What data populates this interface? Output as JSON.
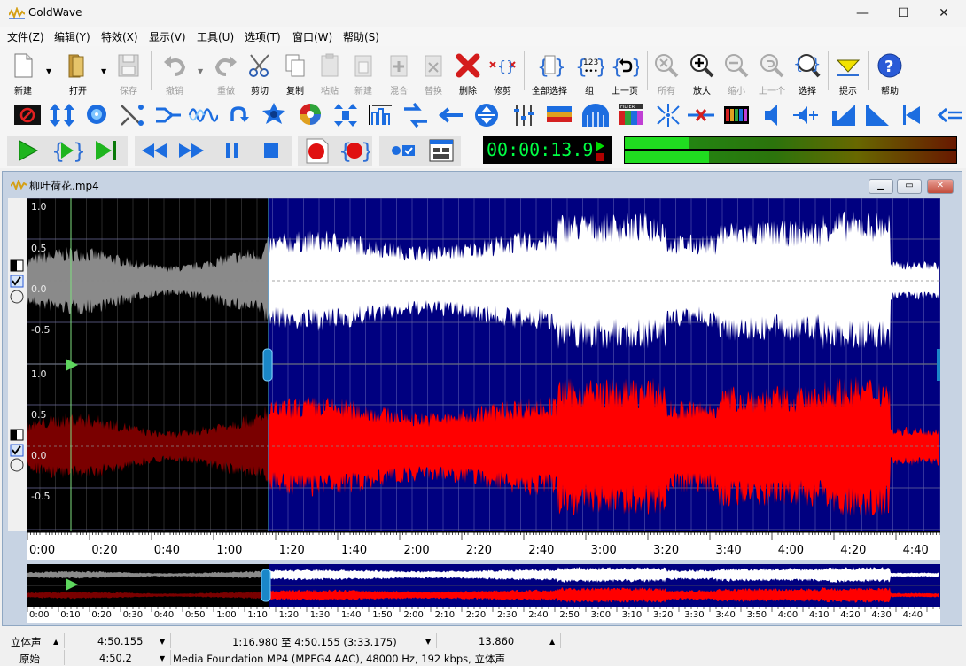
{
  "app": {
    "title": "GoldWave"
  },
  "window_controls": {
    "minimize": "—",
    "maximize": "☐",
    "close": "✕"
  },
  "menu": [
    "文件(Z)",
    "编辑(Y)",
    "特效(X)",
    "显示(V)",
    "工具(U)",
    "选项(T)",
    "窗口(W)",
    "帮助(S)"
  ],
  "toolbar": {
    "buttons": [
      {
        "label": "新建",
        "icon": "new-file-icon"
      },
      {
        "label": "打开",
        "icon": "open-folder-icon"
      },
      {
        "label": "保存",
        "icon": "save-icon"
      },
      {
        "label": "撤销",
        "icon": "undo-icon"
      },
      {
        "label": "重做",
        "icon": "redo-icon"
      },
      {
        "label": "剪切",
        "icon": "cut-icon"
      },
      {
        "label": "复制",
        "icon": "copy-icon"
      },
      {
        "label": "粘贴",
        "icon": "paste-icon"
      },
      {
        "label": "新建",
        "icon": "paste-new-icon"
      },
      {
        "label": "混合",
        "icon": "mix-icon"
      },
      {
        "label": "替换",
        "icon": "replace-icon"
      },
      {
        "label": "删除",
        "icon": "delete-icon"
      },
      {
        "label": "修剪",
        "icon": "trim-icon"
      },
      {
        "label": "全部选择",
        "icon": "select-all-icon"
      },
      {
        "label": "组",
        "icon": "group-icon"
      },
      {
        "label": "上一页",
        "icon": "previous-page-icon"
      },
      {
        "label": "所有",
        "icon": "zoom-all-icon"
      },
      {
        "label": "放大",
        "icon": "zoom-in-icon"
      },
      {
        "label": "缩小",
        "icon": "zoom-out-icon"
      },
      {
        "label": "上一个",
        "icon": "zoom-previous-icon"
      },
      {
        "label": "选择",
        "icon": "zoom-selection-icon"
      },
      {
        "label": "提示",
        "icon": "cue-icon"
      },
      {
        "label": "帮助",
        "icon": "help-icon"
      }
    ]
  },
  "effects_toolbar": [
    "dc-offset-icon",
    "compressor-icon",
    "doppler-icon",
    "echo-icon",
    "equalizer-icon",
    "flanger-icon",
    "invert-icon",
    "reverb-icon",
    "mechanize-icon",
    "noise-reduction-icon",
    "pitch-icon",
    "playback-rate-icon",
    "reverse-icon",
    "resample-icon",
    "volume-shape-icon",
    "channel-mixer-icon",
    "time-warp-icon",
    "spectrum-filter-icon",
    "pan-icon",
    "pop-click-icon",
    "clip-remove-icon",
    "spectrum-icon",
    "speaker-icon",
    "volume-change-icon",
    "fade-in-icon",
    "fade-out-icon",
    "auto-gain-icon",
    "more-effects-icon"
  ],
  "transport": {
    "time": "00:00:13.9",
    "buttons": [
      "play-icon",
      "play-selection-icon",
      "play-to-end-icon",
      "rewind-icon",
      "fast-forward-icon",
      "pause-icon",
      "stop-icon",
      "record-new-icon",
      "record-selection-icon",
      "control-properties-icon",
      "device-controls-icon"
    ]
  },
  "document": {
    "title": "柳叶荷花.mp4",
    "selection_start_fraction": 0.2636,
    "playhead_fraction": 0.0479
  },
  "channels": {
    "left": {
      "color": "#ffffff",
      "y_ticks": [
        "1.0",
        "0.5",
        "0.0",
        "-0.5"
      ]
    },
    "right": {
      "color": "#ff0000",
      "y_ticks": [
        "1.0",
        "0.5",
        "0.0",
        "-0.5"
      ]
    }
  },
  "timeline": {
    "labels": [
      "0:00",
      "0:20",
      "0:40",
      "1:00",
      "1:20",
      "1:40",
      "2:00",
      "2:20",
      "2:40",
      "3:00",
      "3:20",
      "3:40",
      "4:00",
      "4:20",
      "4:40"
    ],
    "overview_labels": [
      "0:00",
      "0:10",
      "0:20",
      "0:30",
      "0:40",
      "0:50",
      "1:00",
      "1:10",
      "1:20",
      "1:30",
      "1:40",
      "1:50",
      "2:00",
      "2:10",
      "2:20",
      "2:30",
      "2:40",
      "2:50",
      "3:00",
      "3:10",
      "3:20",
      "3:30",
      "3:40",
      "3:50",
      "4:00",
      "4:10",
      "4:20",
      "4:30",
      "4:40"
    ]
  },
  "status": {
    "row1": {
      "channels": "立体声",
      "length": "4:50.155",
      "selection": "1:16.980 至 4:50.155 (3:33.175)",
      "position": "13.860"
    },
    "row2": {
      "mode": "原始",
      "length": "4:50.2",
      "format": "Media Foundation MP4 (MPEG4 AAC), 48000 Hz, 192 kbps, 立体声"
    }
  }
}
